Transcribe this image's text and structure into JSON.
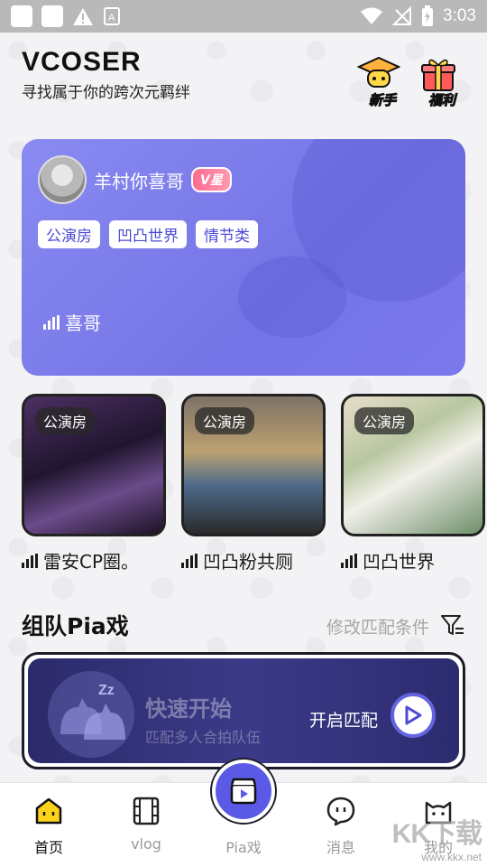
{
  "status_bar": {
    "time": "3:03"
  },
  "header": {
    "brand": "VCOSER",
    "slogan": "寻找属于你的跨次元羁绊",
    "newbie_label": "新手",
    "welfare_label": "福利"
  },
  "featured_room": {
    "owner_name": "羊村你喜哥",
    "badge": "V星",
    "tags": [
      "公演房",
      "凹凸世界",
      "情节类"
    ],
    "room_title": "喜哥"
  },
  "rooms": [
    {
      "tag": "公演房",
      "title": "雷安CP圈。"
    },
    {
      "tag": "公演房",
      "title": "凹凸粉共厕"
    },
    {
      "tag": "公演房",
      "title": "凹凸世界"
    }
  ],
  "team_section": {
    "title": "组队Pia戏",
    "link": "修改匹配条件"
  },
  "quick_match": {
    "title": "快速开始",
    "subtitle": "匹配多人合拍队伍",
    "action": "开启匹配"
  },
  "bottom_nav": {
    "home": "首页",
    "vlog": "vlog",
    "pia": "Pia戏",
    "messages": "消息",
    "mine": "我的"
  },
  "watermark": {
    "line1": "KK下载",
    "line2": "www.kkx.net"
  },
  "colors": {
    "accent": "#5a5ae6",
    "card": "#7b79ea",
    "tag_text": "#4c4ad6",
    "badge": "#ff6b8e"
  }
}
